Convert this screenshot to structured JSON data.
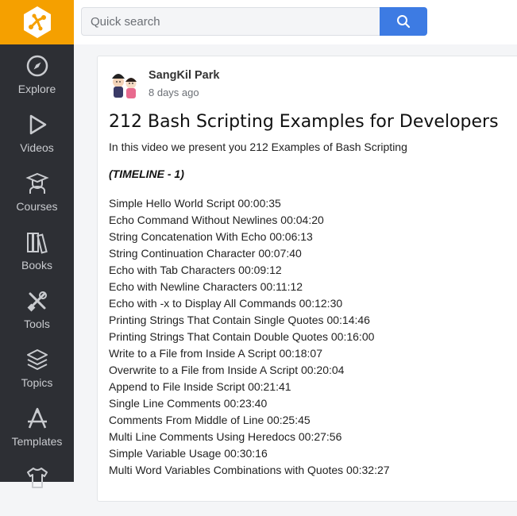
{
  "search": {
    "placeholder": "Quick search"
  },
  "nav": [
    {
      "label": "Explore",
      "icon": "compass-icon"
    },
    {
      "label": "Videos",
      "icon": "play-icon"
    },
    {
      "label": "Courses",
      "icon": "graduate-icon"
    },
    {
      "label": "Books",
      "icon": "books-icon"
    },
    {
      "label": "Tools",
      "icon": "tools-icon"
    },
    {
      "label": "Topics",
      "icon": "layers-icon"
    },
    {
      "label": "Templates",
      "icon": "templates-icon"
    }
  ],
  "post": {
    "author": "SangKil Park",
    "time": "8 days ago",
    "title": "212 Bash Scripting Examples for Developers",
    "intro": "In this video we present you 212 Examples of Bash Scripting",
    "timeline_heading": "(TIMELINE - 1)",
    "timeline": [
      "Simple Hello World Script 00:00:35",
      "Echo Command Without Newlines 00:04:20",
      "String Concatenation With Echo 00:06:13",
      "String Continuation Character 00:07:40",
      "Echo with Tab Characters 00:09:12",
      "Echo with Newline Characters 00:11:12",
      "Echo with -x to Display All Commands 00:12:30",
      "Printing Strings That Contain Single Quotes 00:14:46",
      "Printing Strings That Contain Double Quotes 00:16:00",
      "Write to a File from Inside A Script 00:18:07",
      "Overwrite to a File from Inside A Script 00:20:04",
      "Append to File Inside Script 00:21:41",
      "Single Line Comments 00:23:40",
      "Comments From Middle of Line 00:25:45",
      "Multi Line Comments Using Heredocs 00:27:56",
      "Simple Variable Usage 00:30:16",
      "Multi Word Variables Combinations with Quotes 00:32:27"
    ]
  }
}
